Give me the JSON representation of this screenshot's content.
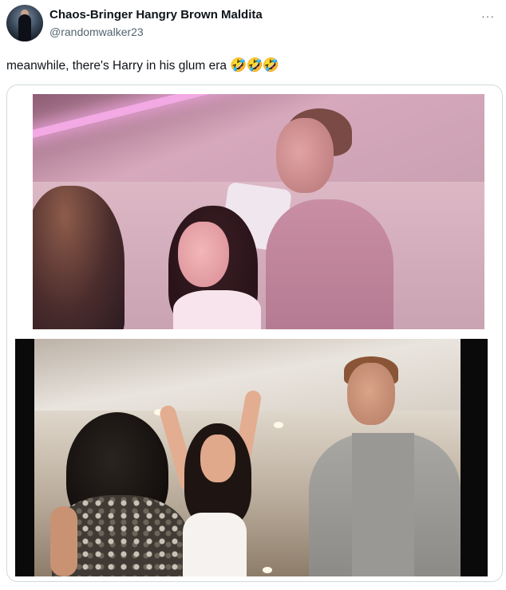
{
  "tweet": {
    "author": {
      "display_name": "Chaos-Bringer Hangry Brown Maldita",
      "handle": "@randomwalker23"
    },
    "more_label": "···",
    "text": "meanwhile, there's Harry in his glum era",
    "emoji": "🤣🤣🤣",
    "media": [
      {
        "kind": "photo",
        "alt": ""
      },
      {
        "kind": "photo",
        "alt": ""
      }
    ]
  },
  "colors": {
    "text_primary": "#0f1419",
    "text_secondary": "#536471",
    "border": "#cfd9de"
  }
}
